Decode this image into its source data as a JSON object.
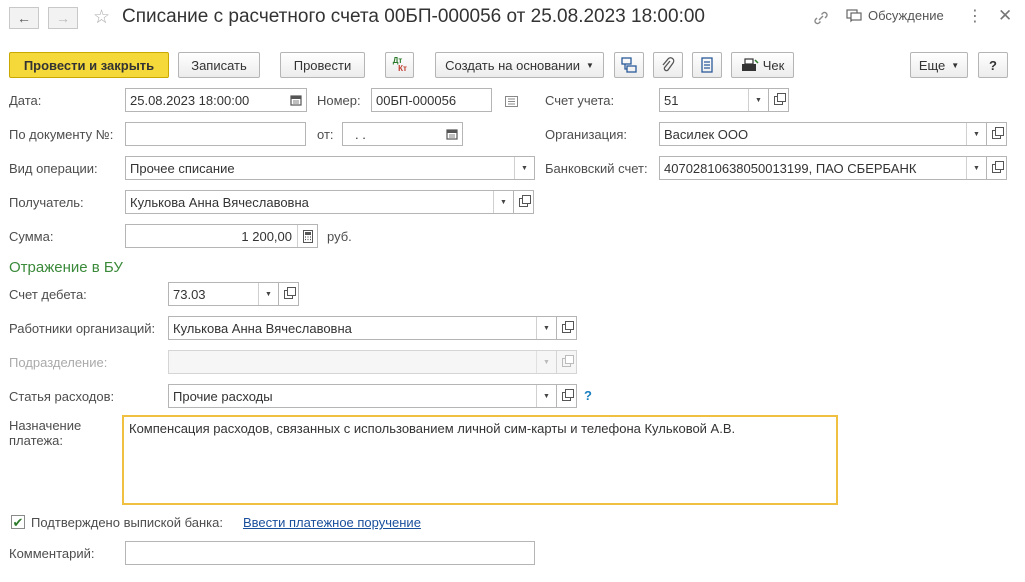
{
  "header": {
    "title": "Списание с расчетного счета 00БП-000056 от 25.08.2023 18:00:00",
    "discussion": "Обсуждение"
  },
  "toolbar": {
    "post_close": "Провести и закрыть",
    "save": "Записать",
    "post": "Провести",
    "dtkt_top": "Дт",
    "dtkt_bottom": "Кт",
    "create_based": "Создать на основании",
    "receipt": "Чек",
    "more": "Еще",
    "help": "?"
  },
  "form": {
    "date": {
      "label": "Дата:",
      "value": "25.08.2023 18:00:00"
    },
    "number": {
      "label": "Номер:",
      "value": "00БП-000056"
    },
    "account": {
      "label": "Счет учета:",
      "value": "51"
    },
    "by_document": {
      "label": "По документу №:",
      "value": ""
    },
    "from": {
      "label": "от:",
      "value": " .  ."
    },
    "organization": {
      "label": "Организация:",
      "value": "Василек ООО"
    },
    "operation": {
      "label": "Вид операции:",
      "value": "Прочее списание"
    },
    "bank_account": {
      "label": "Банковский счет:",
      "value": "40702810638050013199, ПАО СБЕРБАНК"
    },
    "recipient": {
      "label": "Получатель:",
      "value": "Кулькова Анна Вячеславовна"
    },
    "sum": {
      "label": "Сумма:",
      "value": "1 200,00",
      "currency": "руб."
    }
  },
  "accounting": {
    "section_title": "Отражение в БУ",
    "debit_account": {
      "label": "Счет дебета:",
      "value": "73.03"
    },
    "employees": {
      "label": "Работники организаций:",
      "value": "Кулькова Анна Вячеславовна"
    },
    "department": {
      "label": "Подразделение:",
      "value": ""
    },
    "expense_item": {
      "label": "Статья расходов:",
      "value": "Прочие расходы"
    },
    "help_mark": "?"
  },
  "purpose": {
    "label_line1": "Назначение",
    "label_line2": "платежа:",
    "value": "Компенсация расходов, связанных с использованием личной сим-карты и телефона Кульковой А.В."
  },
  "confirm": {
    "label": "Подтверждено выпиской банка:",
    "checked": true,
    "link": "Ввести платежное поручение"
  },
  "comment": {
    "label": "Комментарий:",
    "value": ""
  },
  "colors": {
    "primary_button": "#f5d93a",
    "section": "#3a8a3a",
    "link": "#1a4f9c",
    "focus_border": "#f0c040"
  }
}
